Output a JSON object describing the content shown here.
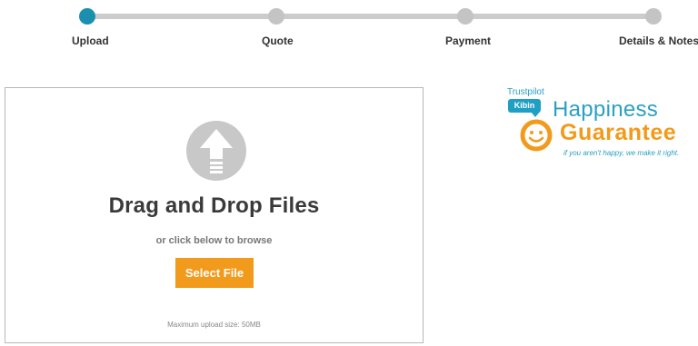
{
  "stepper": {
    "steps": [
      {
        "label": "Upload",
        "active": true
      },
      {
        "label": "Quote",
        "active": false
      },
      {
        "label": "Payment",
        "active": false
      },
      {
        "label": "Details & Notes",
        "active": false
      }
    ],
    "active_color": "#1a8fae",
    "inactive_color": "#c4c4c4"
  },
  "upload": {
    "icon": "upload-arrow-icon",
    "title": "Drag and Drop Files",
    "subtitle": "or click below to browse",
    "button_label": "Select File",
    "limit_text": "Maximum upload size: 50MB",
    "button_color": "#f29a1c"
  },
  "badge": {
    "trustpilot": "Trustpilot",
    "kibin": "Kibin",
    "happiness": "Happiness",
    "guarantee": "Guarantee",
    "tagline": "if you aren't happy, we make it right.",
    "blue": "#2aa0c2",
    "orange": "#f29a1c"
  }
}
